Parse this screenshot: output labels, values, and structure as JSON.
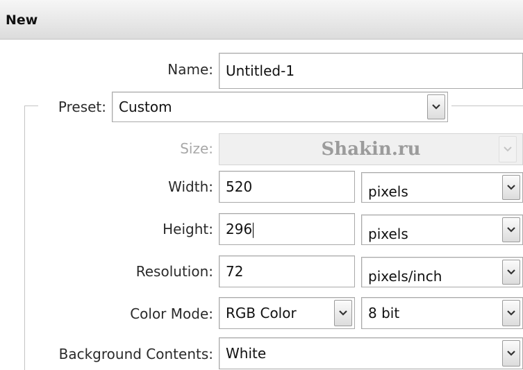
{
  "dialog": {
    "title": "New"
  },
  "form": {
    "name": {
      "label": "Name:",
      "value": "Untitled-1"
    },
    "preset": {
      "label": "Preset:",
      "value": "Custom"
    },
    "size": {
      "label": "Size:",
      "value": "",
      "disabled": true
    },
    "width": {
      "label": "Width:",
      "value": "520",
      "unit": "pixels"
    },
    "height": {
      "label": "Height:",
      "value": "296",
      "unit": "pixels"
    },
    "resolution": {
      "label": "Resolution:",
      "value": "72",
      "unit": "pixels/inch"
    },
    "color_mode": {
      "label": "Color Mode:",
      "value": "RGB Color",
      "depth": "8 bit"
    },
    "background": {
      "label": "Background Contents:",
      "value": "White"
    }
  },
  "watermark": {
    "text": "Shakin.ru"
  },
  "icons": {
    "dropdown": "chevron-down-icon"
  }
}
